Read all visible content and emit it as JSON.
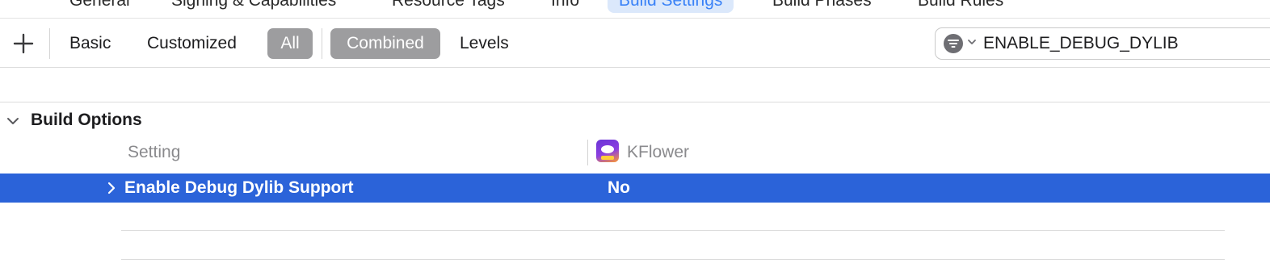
{
  "top_tabs": [
    {
      "label": "General"
    },
    {
      "label": "Signing & Capabilities"
    },
    {
      "label": "Resource Tags"
    },
    {
      "label": "Info"
    },
    {
      "label": "Build Settings",
      "active": true
    },
    {
      "label": "Build Phases"
    },
    {
      "label": "Build Rules"
    }
  ],
  "toolbar": {
    "add_icon": "plus-icon",
    "basic": "Basic",
    "customized": "Customized",
    "all": "All",
    "combined": "Combined",
    "levels": "Levels",
    "search_value": "ENABLE_DEBUG_DYLIB",
    "filter_icon": "filter-icon"
  },
  "section": {
    "title": "Build Options",
    "col_setting": "Setting",
    "col_target": "KFlower"
  },
  "rows": [
    {
      "name": "Enable Debug Dylib Support",
      "value": "No",
      "selected": true
    }
  ],
  "colors": {
    "selection": "#2b63d9",
    "segment_on": "#9d9d9f",
    "active_tab_bg": "#dbe8fb",
    "active_tab_text": "#3a82f7"
  }
}
